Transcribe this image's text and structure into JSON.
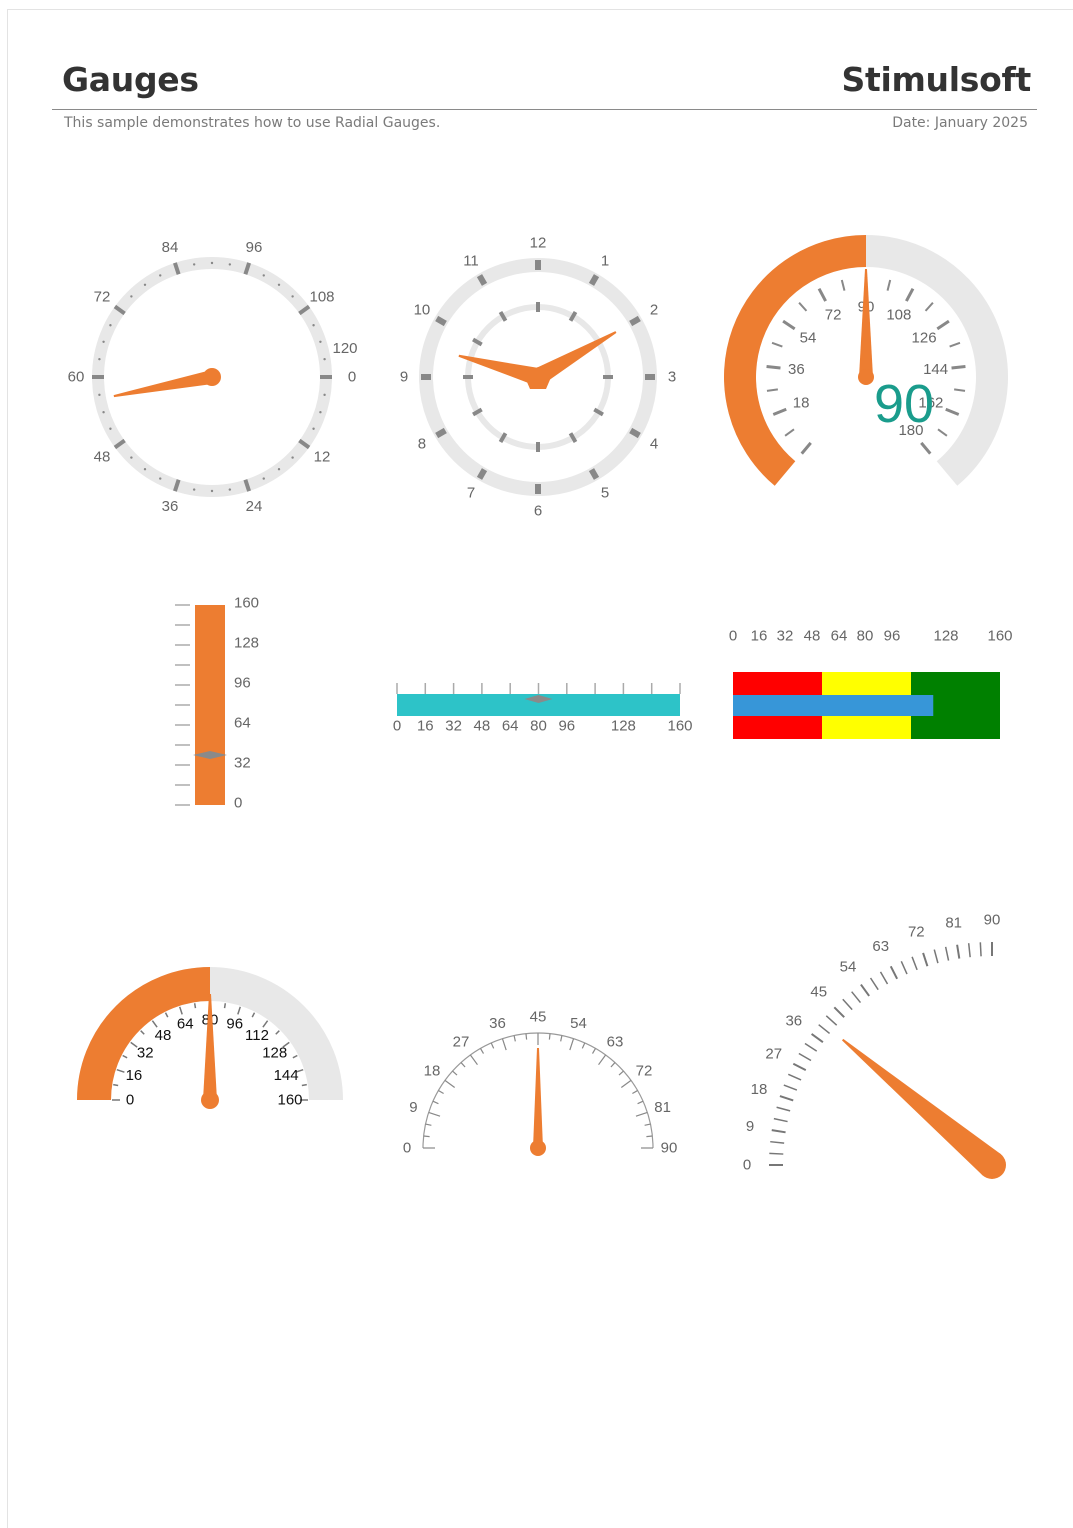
{
  "header": {
    "title": "Gauges",
    "brand": "Stimulsoft",
    "subtitle": "This sample demonstrates how to use Radial Gauges.",
    "date": "Date: January 2025"
  },
  "colors": {
    "accent": "#ED7D31",
    "track": "#E8E8E8",
    "tick": "#888888",
    "label": "#666666",
    "teal": "#2DC3C8",
    "value_text": "#1A9C8C",
    "band_red": "#FF0000",
    "band_yellow": "#FFFF00",
    "band_green": "#008000",
    "bullet_bar": "#3796D8"
  },
  "chart_data": [
    {
      "type": "radial-gauge",
      "name": "circular-scale",
      "scale_labels": [
        "0",
        "12",
        "24",
        "36",
        "48",
        "60",
        "72",
        "84",
        "96",
        "108",
        "120"
      ],
      "value": 60
    },
    {
      "type": "radial-gauge",
      "name": "clock",
      "scale_labels": [
        "12",
        "1",
        "2",
        "3",
        "4",
        "5",
        "6",
        "7",
        "8",
        "9",
        "10",
        "11"
      ],
      "hour_hand": 9.5,
      "minute_hand": 2
    },
    {
      "type": "radial-gauge",
      "name": "speedometer",
      "scale_labels": [
        "18",
        "36",
        "54",
        "72",
        "90",
        "108",
        "126",
        "144",
        "162",
        "180"
      ],
      "value": 90,
      "value_text": "90",
      "range": [
        0,
        180
      ]
    },
    {
      "type": "linear-gauge",
      "name": "vertical-bar",
      "scale_labels": [
        "0",
        "32",
        "64",
        "96",
        "128",
        "160"
      ],
      "range": [
        0,
        160
      ],
      "bar_value": 160,
      "marker_value": 40
    },
    {
      "type": "linear-gauge",
      "name": "horizontal-bar",
      "scale_labels": [
        "0",
        "16",
        "32",
        "48",
        "64",
        "80",
        "96",
        "128",
        "160"
      ],
      "range": [
        0,
        160
      ],
      "bar_value": 160,
      "marker_value": 80
    },
    {
      "type": "bullet-gauge",
      "name": "bullet",
      "scale_labels": [
        "0",
        "16",
        "32",
        "48",
        "64",
        "80",
        "96",
        "128",
        "160"
      ],
      "range": [
        0,
        160
      ],
      "bands": [
        {
          "from": 0,
          "to": 48,
          "color": "#FF0000"
        },
        {
          "from": 48,
          "to": 96,
          "color": "#FFFF00"
        },
        {
          "from": 96,
          "to": 144,
          "color": "#008000"
        }
      ],
      "bar_value": 108
    },
    {
      "type": "radial-gauge",
      "name": "half-gauge-filled",
      "scale_labels": [
        "0",
        "16",
        "32",
        "48",
        "64",
        "80",
        "96",
        "112",
        "128",
        "144",
        "160"
      ],
      "range": [
        0,
        160
      ],
      "value": 80
    },
    {
      "type": "radial-gauge",
      "name": "half-gauge-thin",
      "scale_labels": [
        "0",
        "9",
        "18",
        "27",
        "36",
        "45",
        "54",
        "63",
        "72",
        "81",
        "90"
      ],
      "range": [
        0,
        90
      ],
      "value": 45
    },
    {
      "type": "radial-gauge",
      "name": "quarter-gauge",
      "scale_labels": [
        "0",
        "9",
        "18",
        "27",
        "36",
        "45",
        "54",
        "63",
        "72",
        "81",
        "90"
      ],
      "range": [
        0,
        90
      ],
      "value": 36
    }
  ]
}
